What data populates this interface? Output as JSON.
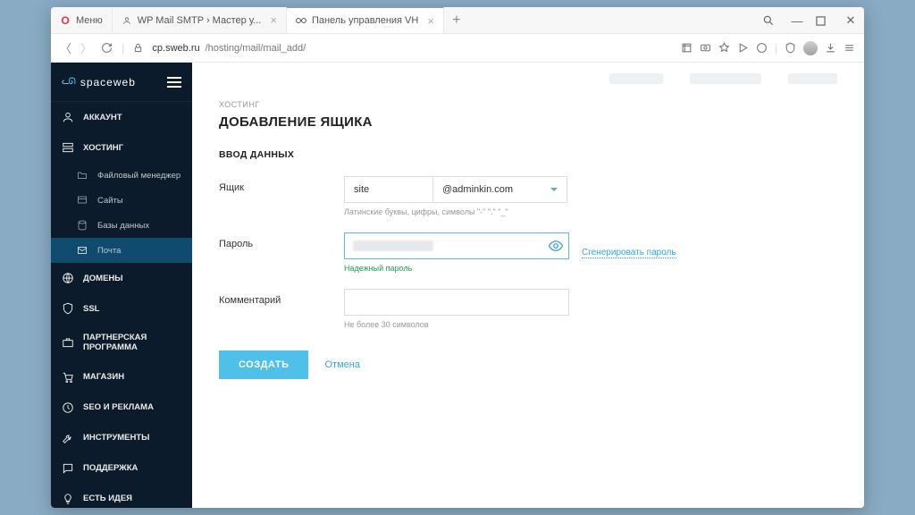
{
  "browser": {
    "tabs": [
      {
        "label": "Меню"
      },
      {
        "label": "WP Mail SMTP › Мастер у..."
      },
      {
        "label": "Панель управления VH"
      }
    ],
    "url_prefix": "cp.sweb.ru",
    "url_path": "/hosting/mail/mail_add/"
  },
  "sidebar": {
    "brand": "spaceweb",
    "items": [
      {
        "label": "АККАУНТ",
        "sub": false,
        "active": false
      },
      {
        "label": "ХОСТИНГ",
        "sub": false,
        "active": false,
        "open": true
      },
      {
        "label": "Файловый менеджер",
        "sub": true,
        "active": false
      },
      {
        "label": "Сайты",
        "sub": true,
        "active": false
      },
      {
        "label": "Базы данных",
        "sub": true,
        "active": false
      },
      {
        "label": "Почта",
        "sub": true,
        "active": true
      },
      {
        "label": "ДОМЕНЫ",
        "sub": false,
        "active": false
      },
      {
        "label": "SSL",
        "sub": false,
        "active": false
      },
      {
        "label": "ПАРТНЕРСКАЯ ПРОГРАММА",
        "sub": false,
        "active": false
      },
      {
        "label": "МАГАЗИН",
        "sub": false,
        "active": false
      },
      {
        "label": "SEO И РЕКЛАМА",
        "sub": false,
        "active": false
      },
      {
        "label": "ИНСТРУМЕНТЫ",
        "sub": false,
        "active": false
      },
      {
        "label": "ПОДДЕРЖКА",
        "sub": false,
        "active": false
      },
      {
        "label": "ЕСТЬ ИДЕЯ",
        "sub": false,
        "active": false
      }
    ]
  },
  "page": {
    "breadcrumb": "ХОСТИНГ",
    "title": "ДОБАВЛЕНИЕ ЯЩИКА",
    "section": "ВВОД ДАННЫХ",
    "mailbox": {
      "label": "Ящик",
      "value": "site",
      "domain": "@adminkin.com",
      "hint": "Латинские буквы, цифры, символы \"-\" \".\" \"_\""
    },
    "password": {
      "label": "Пароль",
      "hint": "Надежный пароль",
      "generate": "Сгенерировать пароль"
    },
    "comment": {
      "label": "Комментарий",
      "hint": "Не более 30 символов"
    },
    "actions": {
      "submit": "СОЗДАТЬ",
      "cancel": "Отмена"
    }
  }
}
